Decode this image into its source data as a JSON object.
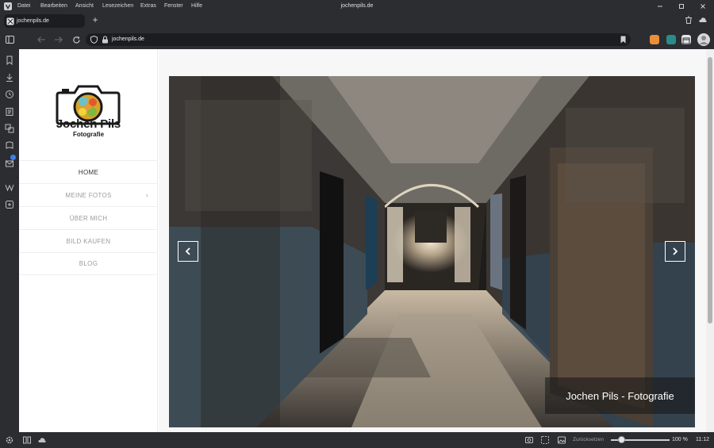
{
  "window": {
    "title": "jochenpils.de",
    "menu": [
      "Datei",
      "Bearbeiten",
      "Ansicht",
      "Lesezeichen",
      "Extras",
      "Fenster",
      "Hilfe"
    ]
  },
  "tab": {
    "title": "jochenpils.de"
  },
  "address": {
    "url": "jochenpils.de"
  },
  "site": {
    "brand_name": "Jochen Pils",
    "brand_sub": "Fotografie",
    "nav": [
      {
        "label": "HOME",
        "active": true
      },
      {
        "label": "MEINE FOTOS",
        "has_submenu": true
      },
      {
        "label": "ÜBER MICH"
      },
      {
        "label": "BILD KAUFEN"
      },
      {
        "label": "BLOG"
      }
    ],
    "slider": {
      "caption": "Jochen Pils - Fotografie",
      "prev_icon": "chevron-left-icon",
      "next_icon": "chevron-right-icon"
    }
  },
  "status": {
    "reset_label": "Zurücksetzen",
    "zoom": "100 %",
    "time": "11:12"
  },
  "colors": {
    "chrome": "#2b2d31",
    "chrome_dark": "#1c1d20",
    "nav_active": "#333333",
    "nav_inactive": "#9b9b9b"
  }
}
